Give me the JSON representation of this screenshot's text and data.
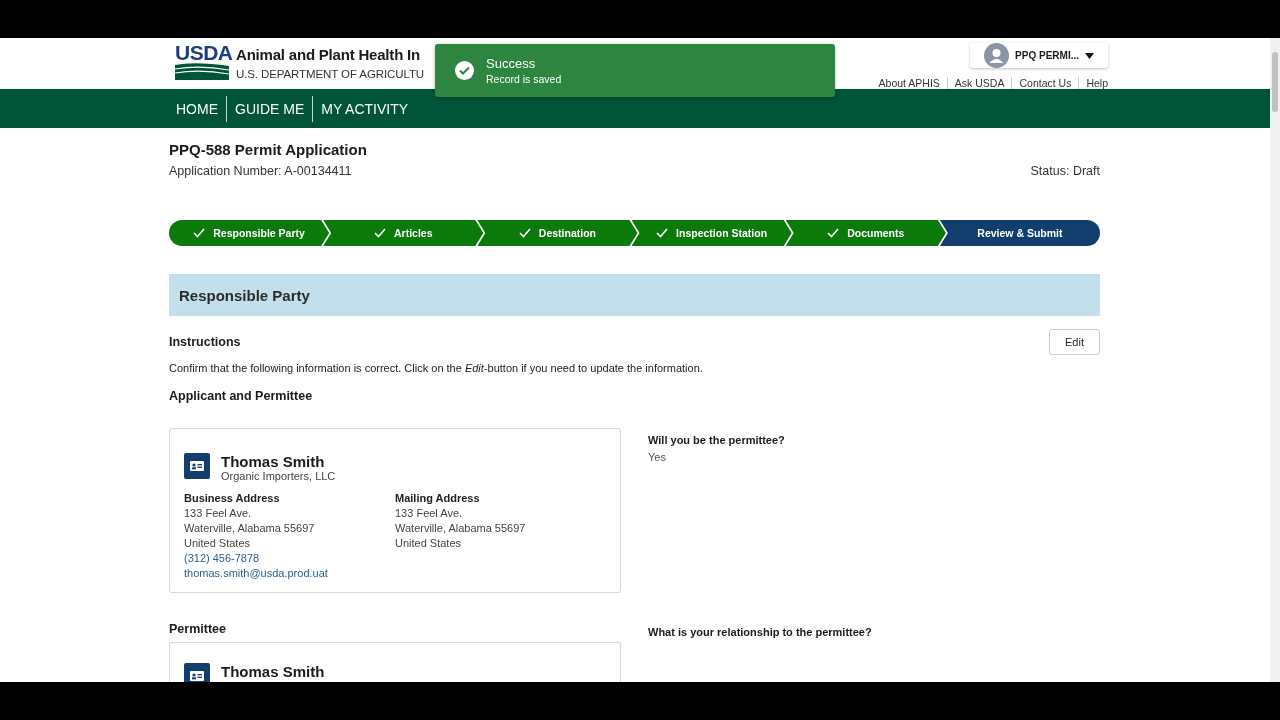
{
  "header": {
    "logo_text": "USDA",
    "agency_name": "Animal and Plant Health In",
    "department": "U.S. DEPARTMENT OF AGRICULTU",
    "user": "PPQ PERMI...",
    "links": [
      "About APHIS",
      "Ask USDA",
      "Contact Us",
      "Help"
    ]
  },
  "toast": {
    "title": "Success",
    "message": "Record is saved"
  },
  "nav": [
    "HOME",
    "GUIDE ME",
    "MY ACTIVITY"
  ],
  "application": {
    "title": "PPQ-588 Permit Application",
    "number": "Application Number: A-00134411",
    "status": "Status: Draft"
  },
  "steps": [
    {
      "label": "Responsible Party",
      "completed": true
    },
    {
      "label": "Articles",
      "completed": true
    },
    {
      "label": "Destination",
      "completed": true
    },
    {
      "label": "Inspection Station",
      "completed": true
    },
    {
      "label": "Documents",
      "completed": true
    },
    {
      "label": "Review & Submit",
      "completed": false
    }
  ],
  "section": {
    "title": "Responsible Party",
    "instructions_label": "Instructions",
    "edit_button": "Edit",
    "instructions": "Confirm that the following information is correct. Click on the *Edit*-button if you need to update the information.",
    "subsection": "Applicant and Permittee"
  },
  "applicant_card": {
    "name": "Thomas Smith",
    "company": "Organic Importers, LLC",
    "addresses": [
      {
        "title": "Business Address",
        "lines": [
          "133 Feel Ave.",
          "Waterville, Alabama 55697",
          "United States"
        ],
        "phone": "(312) 456-7878",
        "email": "thomas.smith@usda.prod.uat"
      },
      {
        "title": "Mailing Address",
        "lines": [
          "133 Feel Ave.",
          "Waterville, Alabama 55697",
          "United States"
        ]
      }
    ]
  },
  "questions": [
    {
      "question": "Will you be the permittee?",
      "answer": "Yes"
    }
  ],
  "permittee": {
    "label": "Permittee",
    "name": "Thomas Smith",
    "question": "What is your relationship to the permittee?"
  }
}
